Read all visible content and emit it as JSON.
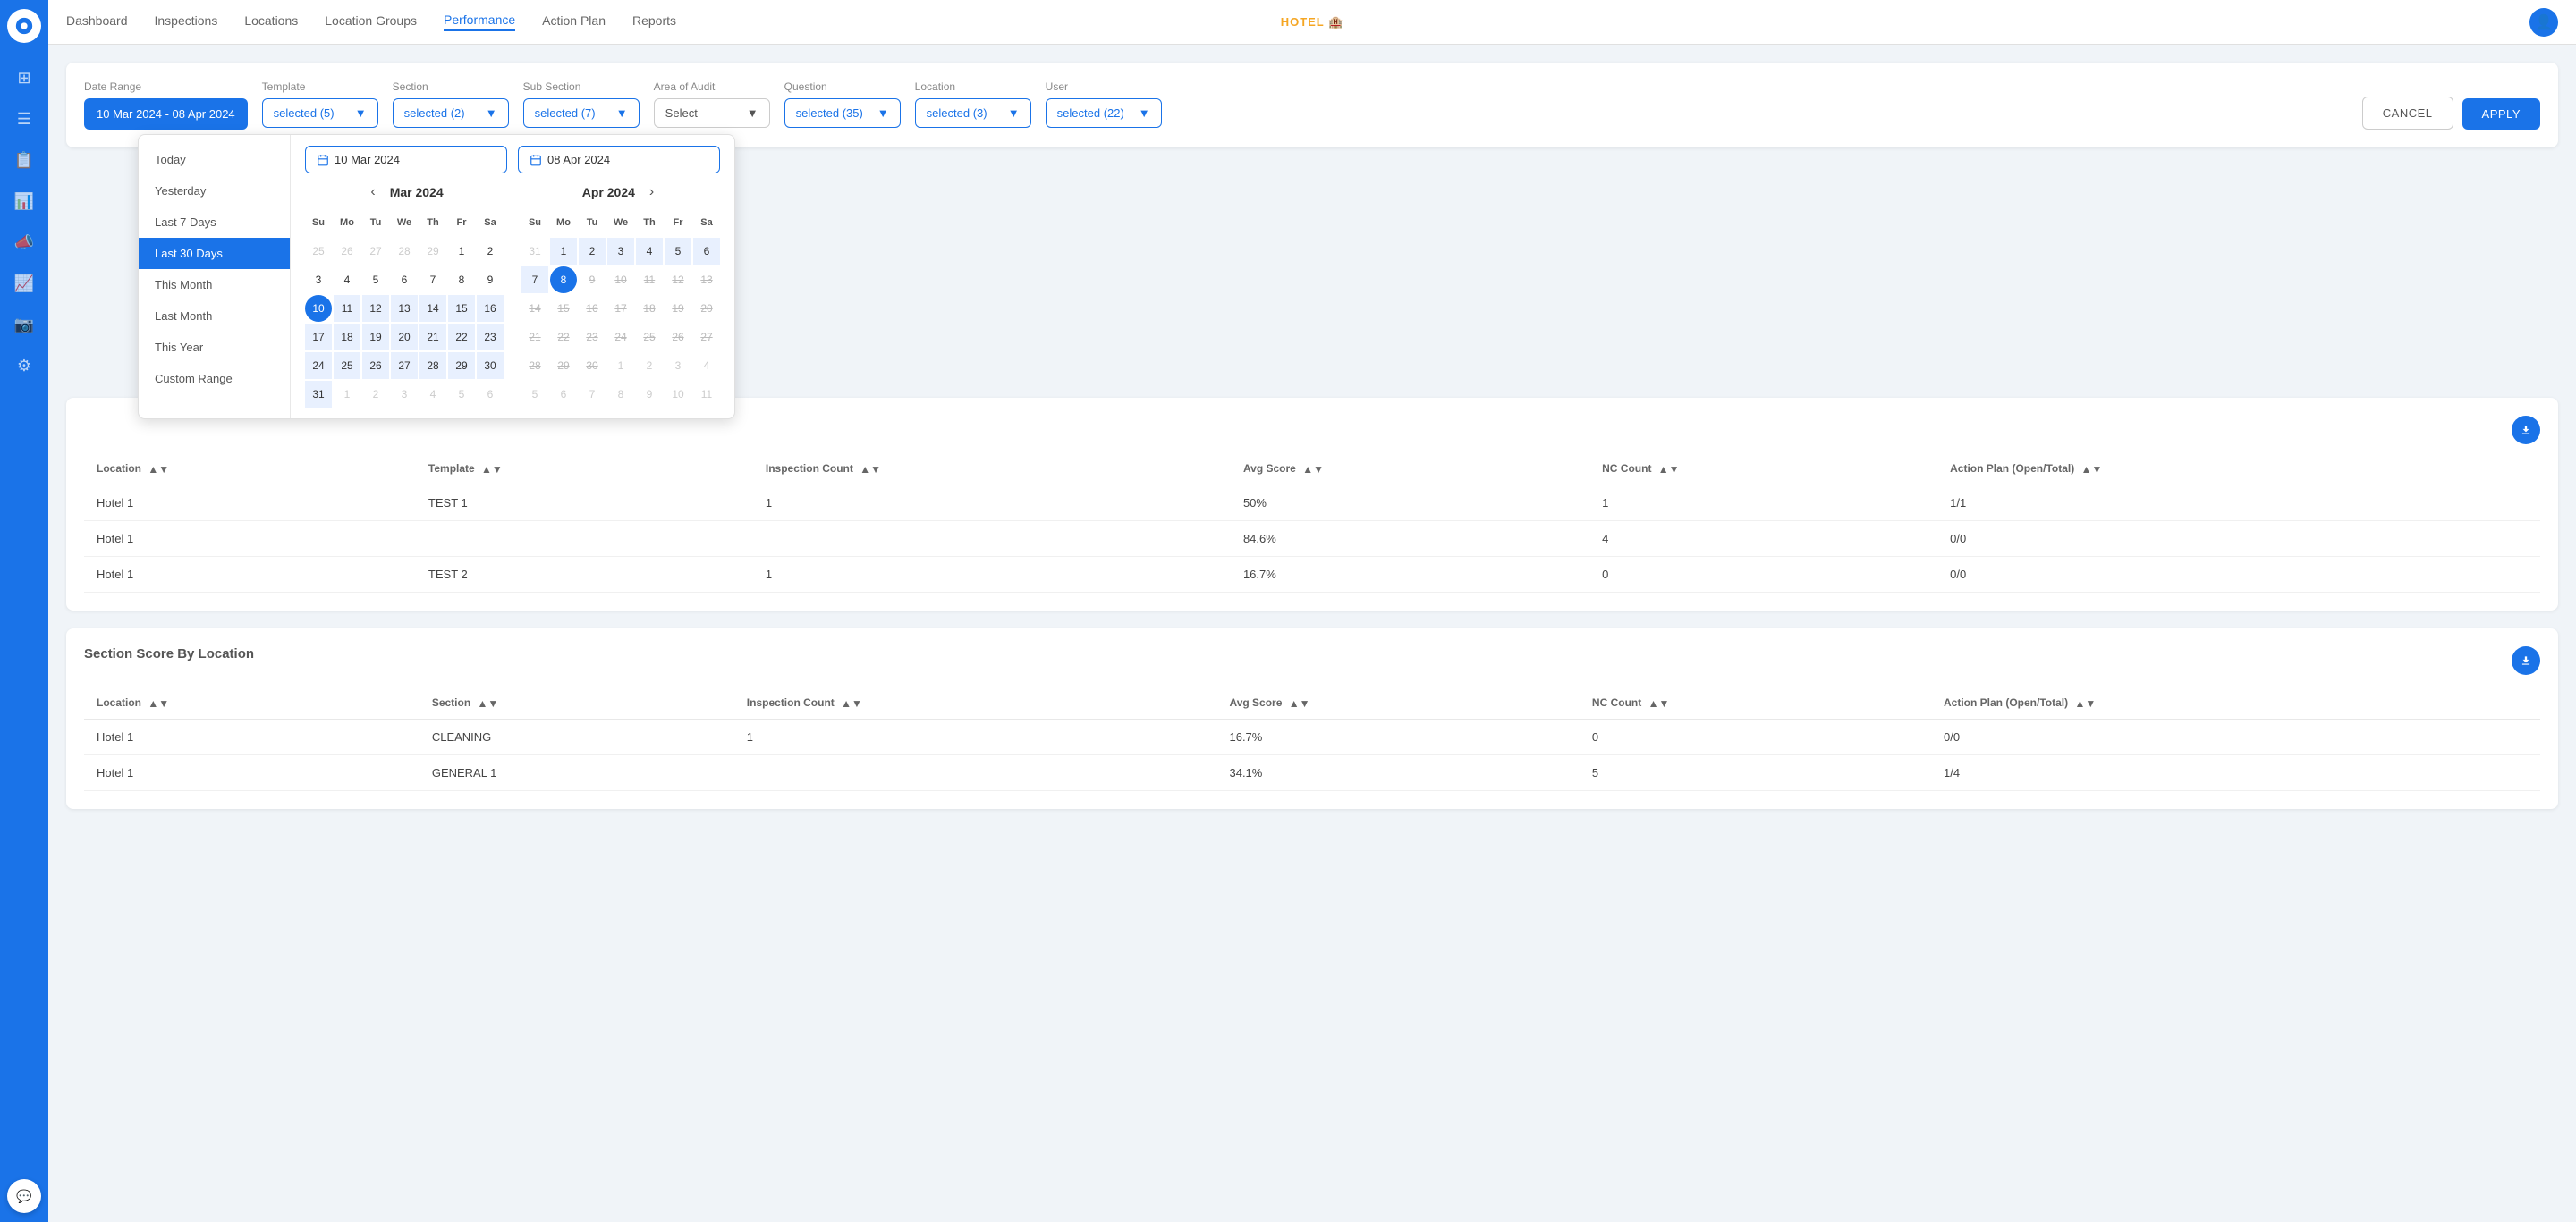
{
  "app": {
    "logo": "HOTEL 🏨",
    "user_icon": "👤"
  },
  "nav": {
    "items": [
      {
        "label": "Dashboard",
        "active": false
      },
      {
        "label": "Inspections",
        "active": false
      },
      {
        "label": "Locations",
        "active": false
      },
      {
        "label": "Location Groups",
        "active": false
      },
      {
        "label": "Performance",
        "active": true
      },
      {
        "label": "Action Plan",
        "active": false
      },
      {
        "label": "Reports",
        "active": false
      }
    ]
  },
  "sidebar": {
    "icons": [
      "grid",
      "list",
      "clipboard",
      "bar-chart",
      "megaphone",
      "chart",
      "camera",
      "settings"
    ]
  },
  "filters": {
    "date_range_label": "Date Range",
    "date_range_value": "10 Mar 2024 - 08 Apr 2024",
    "template_label": "Template",
    "template_value": "selected (5)",
    "section_label": "Section",
    "section_value": "selected (2)",
    "subsection_label": "Sub Section",
    "subsection_value": "selected (7)",
    "area_label": "Area of Audit",
    "area_placeholder": "Select",
    "question_label": "Question",
    "question_value": "selected (35)",
    "location_label": "Location",
    "location_value": "selected (3)",
    "user_label": "User",
    "user_value": "selected (22)",
    "cancel_label": "CANCEL",
    "apply_label": "APPLY"
  },
  "datepicker": {
    "start_date": "10 Mar 2024",
    "end_date": "08 Apr 2024",
    "presets": [
      {
        "label": "Today",
        "active": false
      },
      {
        "label": "Yesterday",
        "active": false
      },
      {
        "label": "Last 7 Days",
        "active": false
      },
      {
        "label": "Last 30 Days",
        "active": true
      },
      {
        "label": "This Month",
        "active": false
      },
      {
        "label": "Last Month",
        "active": false
      },
      {
        "label": "This Year",
        "active": false
      },
      {
        "label": "Custom Range",
        "active": false
      }
    ],
    "mar2024": {
      "month_label": "Mar 2024",
      "days_header": [
        "Su",
        "Mo",
        "Tu",
        "We",
        "Th",
        "Fr",
        "Sa"
      ],
      "weeks": [
        [
          {
            "n": "25",
            "om": true
          },
          {
            "n": "26",
            "om": true
          },
          {
            "n": "27",
            "om": true
          },
          {
            "n": "28",
            "om": true
          },
          {
            "n": "29",
            "om": true
          },
          {
            "n": "1",
            "s": false
          },
          {
            "n": "2",
            "s": false
          }
        ],
        [
          {
            "n": "3"
          },
          {
            "n": "4"
          },
          {
            "n": "5"
          },
          {
            "n": "6"
          },
          {
            "n": "7"
          },
          {
            "n": "8"
          },
          {
            "n": "9"
          }
        ],
        [
          {
            "n": "10",
            "start": true
          },
          {
            "n": "11",
            "in": true
          },
          {
            "n": "12",
            "in": true
          },
          {
            "n": "13",
            "in": true
          },
          {
            "n": "14",
            "in": true
          },
          {
            "n": "15",
            "in": true
          },
          {
            "n": "16",
            "in": true
          }
        ],
        [
          {
            "n": "17",
            "in": true
          },
          {
            "n": "18",
            "in": true
          },
          {
            "n": "19",
            "in": true
          },
          {
            "n": "20",
            "in": true
          },
          {
            "n": "21",
            "in": true
          },
          {
            "n": "22",
            "in": true
          },
          {
            "n": "23",
            "in": true
          }
        ],
        [
          {
            "n": "24",
            "in": true
          },
          {
            "n": "25",
            "in": true
          },
          {
            "n": "26",
            "in": true
          },
          {
            "n": "27",
            "in": true
          },
          {
            "n": "28",
            "in": true
          },
          {
            "n": "29",
            "in": true
          },
          {
            "n": "30",
            "in": true
          }
        ],
        [
          {
            "n": "31",
            "in": true
          },
          {
            "n": "1",
            "om": true
          },
          {
            "n": "2",
            "om": true
          },
          {
            "n": "3",
            "om": true
          },
          {
            "n": "4",
            "om": true
          },
          {
            "n": "5",
            "om": true
          },
          {
            "n": "6",
            "om": true
          }
        ]
      ]
    },
    "apr2024": {
      "month_label": "Apr 2024",
      "days_header": [
        "Su",
        "Mo",
        "Tu",
        "We",
        "Th",
        "Fr",
        "Sa"
      ],
      "weeks": [
        [
          {
            "n": "31",
            "om": true
          },
          {
            "n": "1",
            "in": true
          },
          {
            "n": "2",
            "in": true
          },
          {
            "n": "3",
            "in": true
          },
          {
            "n": "4",
            "in": true
          },
          {
            "n": "5",
            "in": true
          },
          {
            "n": "6",
            "in": true
          }
        ],
        [
          {
            "n": "7",
            "in": true
          },
          {
            "n": "8",
            "end": true
          },
          {
            "n": "9",
            "s": true
          },
          {
            "n": "10",
            "s": true
          },
          {
            "n": "11",
            "s": true
          },
          {
            "n": "12",
            "s": true
          },
          {
            "n": "13",
            "s": true
          }
        ],
        [
          {
            "n": "14",
            "s": true
          },
          {
            "n": "15",
            "s": true
          },
          {
            "n": "16",
            "s": true
          },
          {
            "n": "17",
            "s": true
          },
          {
            "n": "18",
            "s": true
          },
          {
            "n": "19",
            "s": true
          },
          {
            "n": "20",
            "s": true
          }
        ],
        [
          {
            "n": "21",
            "s": true
          },
          {
            "n": "22",
            "s": true
          },
          {
            "n": "23",
            "s": true
          },
          {
            "n": "24",
            "s": true
          },
          {
            "n": "25",
            "s": true
          },
          {
            "n": "26",
            "s": true
          },
          {
            "n": "27",
            "s": true
          }
        ],
        [
          {
            "n": "28",
            "s": true
          },
          {
            "n": "29",
            "s": true
          },
          {
            "n": "30",
            "s": true
          },
          {
            "n": "1",
            "om": true
          },
          {
            "n": "2",
            "om": true
          },
          {
            "n": "3",
            "om": true
          },
          {
            "n": "4",
            "om": true
          }
        ],
        [
          {
            "n": "5",
            "om": true
          },
          {
            "n": "6",
            "om": true
          },
          {
            "n": "7",
            "om": true
          },
          {
            "n": "8",
            "om": true
          },
          {
            "n": "9",
            "om": true
          },
          {
            "n": "10",
            "om": true
          },
          {
            "n": "11",
            "om": true
          }
        ]
      ]
    }
  },
  "table1": {
    "section_title": "",
    "columns": [
      "Location",
      "Template",
      "Inspection Count",
      "Avg Score",
      "NC Count",
      "Action Plan (Open/Total)"
    ],
    "rows": [
      {
        "location": "Hotel 1",
        "template": "TEST 1",
        "count": "1",
        "avg": "50%",
        "nc": "1",
        "action": "1/1"
      },
      {
        "location": "Hotel 1",
        "template": "",
        "count": "",
        "avg": "84.6%",
        "nc": "4",
        "action": "0/0"
      },
      {
        "location": "Hotel 1",
        "template": "TEST 2",
        "count": "1",
        "avg": "16.7%",
        "nc": "0",
        "action": "0/0"
      }
    ]
  },
  "table2": {
    "section_title": "Section Score By Location",
    "columns": [
      "Location",
      "Section",
      "Inspection Count",
      "Avg Score",
      "NC Count",
      "Action Plan (Open/Total)"
    ],
    "rows": [
      {
        "location": "Hotel 1",
        "section": "CLEANING",
        "count": "1",
        "avg": "16.7%",
        "nc": "0",
        "action": "0/0"
      },
      {
        "location": "Hotel 1",
        "section": "GENERAL 1",
        "count": "",
        "avg": "34.1%",
        "nc": "5",
        "action": "1/4"
      }
    ]
  }
}
